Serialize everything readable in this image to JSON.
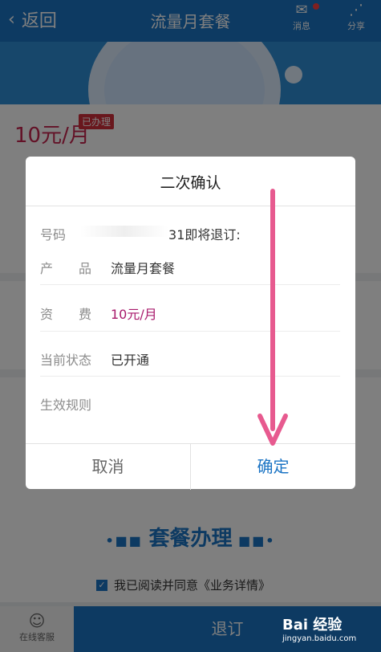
{
  "header": {
    "back_label": "返回",
    "title": "流量月套餐",
    "message_label": "消息",
    "share_label": "分享"
  },
  "background": {
    "price": "10元/月",
    "badge": "已办理",
    "section_title": "套餐办理",
    "agree_text": "我已阅读并同意《业务详情》",
    "online_service": "在线客服",
    "unsubscribe_label": "退订"
  },
  "dialog": {
    "title": "二次确认",
    "notice_prefix": "号码",
    "notice_suffix": "31即将退订:",
    "rows": [
      {
        "label": "产　　品",
        "value": "流量月套餐"
      },
      {
        "label": "资　　费",
        "value": "10元/月"
      },
      {
        "label": "当前状态",
        "value": "已开通"
      },
      {
        "label": "生效规则",
        "value": ""
      }
    ],
    "cancel_label": "取消",
    "confirm_label": "确定"
  },
  "watermark": {
    "brand": "Bai 经验",
    "url": "jingyan.baidu.com"
  },
  "colors": {
    "primary": "#1b74c4",
    "price": "#c6254f",
    "arrow": "#e75a8f"
  }
}
